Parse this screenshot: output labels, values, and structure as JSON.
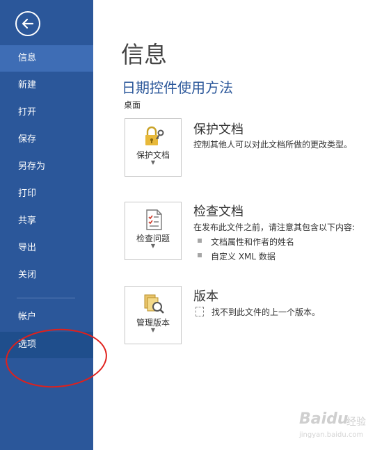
{
  "sidebar": {
    "back_icon": "back-arrow-icon",
    "items": [
      {
        "label": "信息",
        "state": "active"
      },
      {
        "label": "新建"
      },
      {
        "label": "打开"
      },
      {
        "label": "保存"
      },
      {
        "label": "另存为"
      },
      {
        "label": "打印"
      },
      {
        "label": "共享"
      },
      {
        "label": "导出"
      },
      {
        "label": "关闭"
      },
      {
        "label": "帐户"
      },
      {
        "label": "选项",
        "state": "hover"
      }
    ],
    "bg_color": "#2b579a",
    "active_color": "#3e6db5"
  },
  "main": {
    "page_title": "信息",
    "doc_title": "日期控件使用方法",
    "doc_location": "桌面",
    "sections": [
      {
        "tile_label": "保护文档",
        "tile_icon": "lock-key-icon",
        "title": "保护文档",
        "description": "控制其他人可以对此文档所做的更改类型。"
      },
      {
        "tile_label": "检查问题",
        "tile_icon": "checklist-icon",
        "title": "检查文档",
        "description": "在发布此文件之前，请注意其包含以下内容:",
        "bullets": [
          "文档属性和作者的姓名",
          "自定义 XML 数据"
        ]
      },
      {
        "tile_label": "管理版本",
        "tile_icon": "versions-magnifier-icon",
        "title": "版本",
        "description": "找不到此文件的上一个版本。"
      }
    ]
  },
  "annotation": {
    "color": "#e0201b"
  },
  "watermark": {
    "main": "Baidu",
    "sub": "经验",
    "url": "jingyan.baidu.com"
  }
}
